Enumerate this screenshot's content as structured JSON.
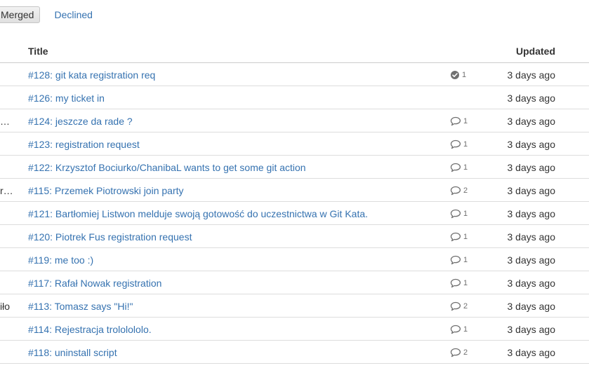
{
  "tabs": {
    "merged": "Merged",
    "declined": "Declined"
  },
  "table": {
    "columns": {
      "title": "Title",
      "updated": "Updated"
    },
    "rows": [
      {
        "left": "",
        "title": "#128: git kata registration req",
        "icon": "approved-check-icon",
        "count": "1",
        "updated": "3 days ago"
      },
      {
        "left": "",
        "title": "#126: my ticket in",
        "icon": "",
        "count": "",
        "updated": "3 days ago"
      },
      {
        "left": "…",
        "title": "#124: jeszcze da rade ?",
        "icon": "comment-icon",
        "count": "1",
        "updated": "3 days ago"
      },
      {
        "left": "",
        "title": "#123: registration request",
        "icon": "comment-icon",
        "count": "1",
        "updated": "3 days ago"
      },
      {
        "left": "",
        "title": "#122: Krzysztof Bociurko/ChanibaL wants to get some git action",
        "icon": "comment-icon",
        "count": "1",
        "updated": "3 days ago"
      },
      {
        "left": "r…",
        "title": "#115: Przemek Piotrowski join party",
        "icon": "comment-icon",
        "count": "2",
        "updated": "3 days ago"
      },
      {
        "left": "",
        "title": "#121: Bartłomiej Listwon melduje swoją gotowość do uczestnictwa w Git Kata.",
        "icon": "comment-icon",
        "count": "1",
        "updated": "3 days ago"
      },
      {
        "left": "",
        "title": "#120: Piotrek Fus registration request",
        "icon": "comment-icon",
        "count": "1",
        "updated": "3 days ago"
      },
      {
        "left": "",
        "title": "#119: me too :)",
        "icon": "comment-icon",
        "count": "1",
        "updated": "3 days ago"
      },
      {
        "left": "",
        "title": "#117: Rafał Nowak registration",
        "icon": "comment-icon",
        "count": "1",
        "updated": "3 days ago"
      },
      {
        "left": "iło",
        "title": "#113: Tomasz says \"Hi!\"",
        "icon": "comment-icon",
        "count": "2",
        "updated": "3 days ago"
      },
      {
        "left": "",
        "title": "#114: Rejestracja trololololo.",
        "icon": "comment-icon",
        "count": "1",
        "updated": "3 days ago"
      },
      {
        "left": "",
        "title": "#118: uninstall script",
        "icon": "comment-icon",
        "count": "2",
        "updated": "3 days ago"
      }
    ]
  }
}
